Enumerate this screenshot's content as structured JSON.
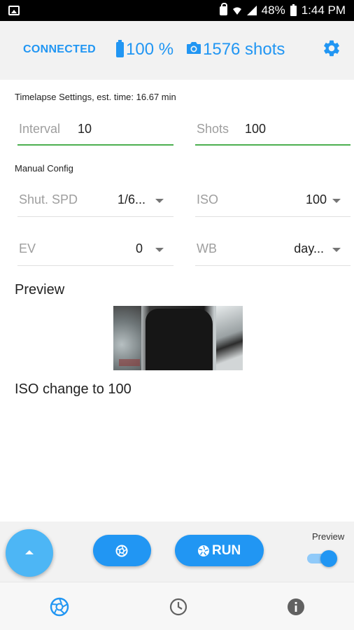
{
  "status_bar": {
    "battery": "48%",
    "time": "1:44 PM",
    "icons": [
      "image-icon",
      "lock-icon",
      "wifi-icon",
      "signal-icon",
      "battery-icon"
    ]
  },
  "header": {
    "connection": "CONNECTED",
    "battery": "100 %",
    "shots": "1576 shots",
    "accent": "#2196f3"
  },
  "timelapse": {
    "section_label": "Timelapse Settings, est. time: 16.67 min",
    "interval_label": "Interval",
    "interval_value": "10",
    "shots_label": "Shots",
    "shots_value": "100"
  },
  "manual": {
    "section_label": "Manual Config",
    "shutter_label": "Shut. SPD",
    "shutter_value": "1/6...",
    "iso_label": "ISO",
    "iso_value": "100",
    "ev_label": "EV",
    "ev_value": "0",
    "wb_label": "WB",
    "wb_value": "day..."
  },
  "preview": {
    "title": "Preview",
    "status_message": "ISO change to 100"
  },
  "actions": {
    "run_label": "RUN",
    "preview_toggle_label": "Preview",
    "preview_toggle_on": true
  },
  "bottom_nav": {
    "items": [
      "aperture-icon",
      "clock-icon",
      "info-icon"
    ]
  }
}
